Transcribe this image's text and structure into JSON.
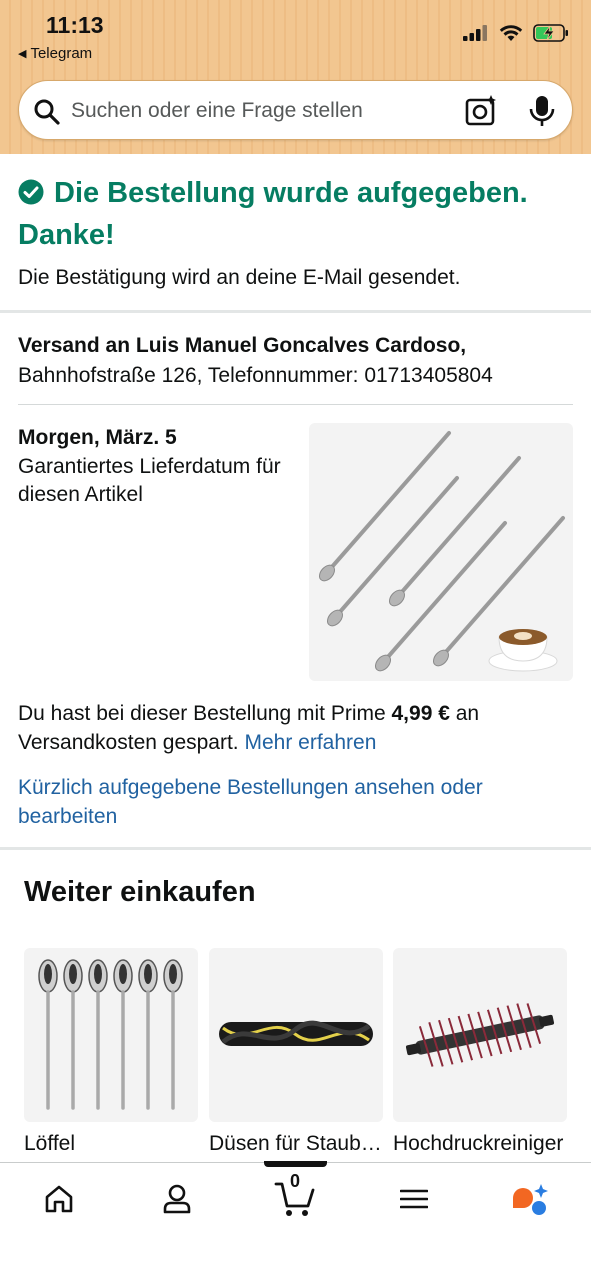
{
  "status_bar": {
    "time": "11:13",
    "back_app": "Telegram"
  },
  "search": {
    "placeholder": "Suchen oder eine Frage stellen"
  },
  "confirmation": {
    "title": "Die Bestellung wurde aufgegeben. Danke!",
    "subtitle": "Die Bestätigung wird an deine E-Mail gesendet."
  },
  "shipping": {
    "name": "Versand an Luis Manuel Goncalves Cardoso,",
    "address": "Bahnhofstraße 126, Telefonnummer: 01713405804"
  },
  "delivery": {
    "date": "Morgen, März. 5",
    "note": "Garantiertes Lieferdatum für diesen Artikel"
  },
  "prime": {
    "text_before": "Du hast bei dieser Bestellung mit Prime ",
    "amount": "4,99 €",
    "text_after": " an Versandkosten gespart.",
    "link": "Mehr erfahren"
  },
  "orders_link": "Kürzlich aufgegebene Bestellungen ansehen oder bearbeiten",
  "continue_shopping": {
    "title": "Weiter einkaufen",
    "items": [
      {
        "label": "Löffel"
      },
      {
        "label": "Düsen für Staubsauger"
      },
      {
        "label": "Hochdruckreiniger"
      }
    ]
  },
  "bottom_nav": {
    "cart_count": "0",
    "items": [
      "home-icon",
      "account-icon",
      "cart-icon",
      "menu-icon",
      "assistant-icon"
    ]
  },
  "colors": {
    "header_bg": "#f0c38c",
    "success_green": "#067d62",
    "link_blue": "#2162a1"
  }
}
